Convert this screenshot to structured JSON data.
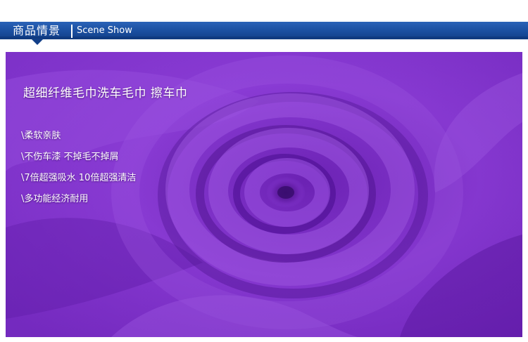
{
  "header": {
    "title_cn": "商品情景",
    "title_en": "Scene Show"
  },
  "photo": {
    "subject": "purple-microfiber-towel-swirl",
    "title": "超细纤维毛巾洗车毛巾  擦车巾",
    "features": [
      "\\柔软亲肤",
      "\\不伤车漆  不掉毛不掉屑",
      "\\7倍超强吸水  10倍超强清洁",
      "\\多功能经济耐用"
    ]
  },
  "colors": {
    "header_blue": "#1a4e9f",
    "towel_purple": "#7b2cc4",
    "text": "#ffffff"
  }
}
